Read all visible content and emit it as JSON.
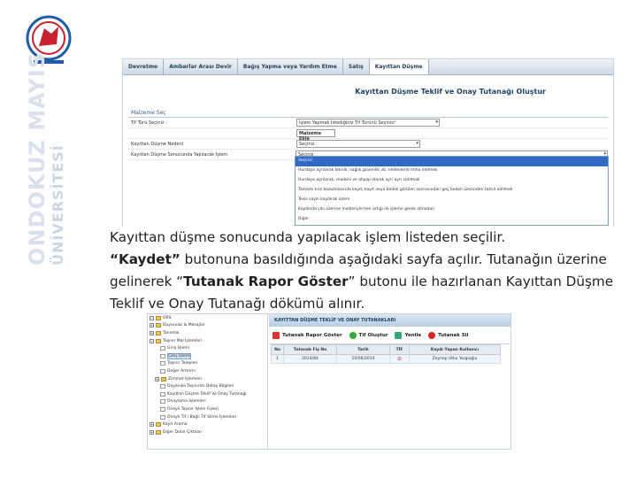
{
  "colors": {
    "accent": "#1f4466",
    "selected": "#316ac5",
    "logo_red": "#c8202f",
    "logo_blue": "#1f5ca8"
  },
  "branding": {
    "line1": "ONDOKUZ MAYIS",
    "line2": "ÜNİVERSİTESİ"
  },
  "top_screen": {
    "tabs": [
      "Devretme",
      "Ambarlar Arası Devir",
      "Bağış Yapma veya Yardım Etme",
      "Satış",
      "Kayıttan Düşme"
    ],
    "form_title": "Kayıttan Düşme Teklif ve Onay Tutanağı Oluştur",
    "section": "Malzeme Seç",
    "fields": [
      {
        "label": "Tif Türü Seçiniz :",
        "value": "İşlem Yapmak İstediğiniz Tif Türünü Seçiniz!"
      },
      {
        "label": "",
        "value": "Malzeme Ekle"
      },
      {
        "label": "Kayıttan Düşme Nedeni",
        "value": "Seçiniz"
      },
      {
        "label": "Kayıttan Düşme Sonucunda Yapılacak İşlem",
        "value": "Seçiniz"
      }
    ],
    "dropdown_options": [
      "Seçiniz",
      "Hurdaya ayrılarak teknik, sağlık,güvenlik vb. nedenlerle imha edilmek",
      "Hurdaya ayrılarak, madeni ve ahşap olarak ayrı ayrı satılmak",
      "Tamamı kriz bozulmasında kayıt, kayıt veya bedeli görülen sonrasından geç bedeli üzerinden tahsil edilmek",
      "Tesis sayılı kaydırak üzere",
      "Kaydında çıkı üzerine malzeriyle hen artığı ile işleme gerek olmadan",
      "Diğer"
    ]
  },
  "description": {
    "l1": "Kayıttan düşme sonucunda yapılacak işlem listeden seçilir.",
    "b1": "“Kaydet”",
    "l2": " butonuna basıldığında aşağıdaki sayfa açılır. Tutanağın üzerine gelinerek “",
    "b2": "Tutanak Rapor Göster",
    "l3": "” butonu ile hazırlanan Kayıttan Düşme Teklif ve Onay Tutanağı dökümü alınır."
  },
  "bottom_screen": {
    "tree": [
      "ORS",
      "Duyurular & Mesajlar",
      "Tanımlar",
      "Taşınır Mal İşlemleri",
      "Giriş İşlemi",
      "Çıkış İşlemi",
      "Taşınır Talepleri",
      "Değer Artırımı",
      "Zimmet İşlemleri",
      "Dayanıklı Taşınırlar Detay Bilgileri",
      "Kayıttan Düşme Teklif Ve Onay Tutanağı",
      "Onaylama İşlemleri",
      "Onaylı Taşınır İşlem Fişleri",
      "Onaylı Tif / Bağlı Tif Silme İşlemleri",
      "Kayıt Arama",
      "Diğer Dolar Çıktıları"
    ],
    "panel_title": "KAYITTAN DÜŞME TEKLİF VE ONAY TUTANAKLARI",
    "buttons": [
      "Tutanak Rapor Göster",
      "Tif Oluştur",
      "Yenile",
      "Tutanak Sil"
    ],
    "table": {
      "headers": [
        "No",
        "Tutanak Fiş No",
        "Tarih",
        "TİF",
        "Kaydı Yapan Kullanıcı"
      ],
      "rows": [
        [
          "1",
          "2014/84",
          "10/06/2014",
          "",
          "Zeynep Utku Yargıoğlu"
        ]
      ]
    }
  }
}
